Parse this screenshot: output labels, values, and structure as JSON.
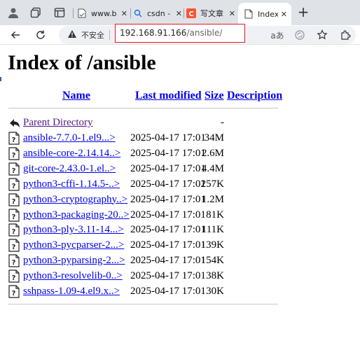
{
  "browser": {
    "tabs": [
      {
        "title": "www.b",
        "favicon": "page-icon"
      },
      {
        "title": "csdn -",
        "favicon": "search-icon"
      },
      {
        "title": "写文章",
        "favicon": "csdn-icon"
      },
      {
        "title": "Index",
        "favicon": "page-icon",
        "active": true
      }
    ],
    "close_glyph": "✕",
    "new_tab_glyph": "+",
    "security_label": "不安全",
    "url_host": "192.168.91.166",
    "url_path": "/ansible/",
    "read_aloud_glyph": "aあ",
    "colors": {
      "tabstrip": "#dfe3e8",
      "highlight_border": "#e2191c",
      "csdn_brand": "#fc5531"
    }
  },
  "page": {
    "heading": "Index of /ansible",
    "columns": {
      "name": "Name",
      "last_modified": "Last modified",
      "size": "Size",
      "description": "Description"
    },
    "parent": {
      "name": "Parent Directory",
      "size": "-"
    },
    "files": [
      {
        "name": "ansible-7.7.0-1.el9...>",
        "modified": "2025-04-17 17:01",
        "size": "34M"
      },
      {
        "name": "ansible-core-2.14.14..>",
        "modified": "2025-04-17 17:01",
        "size": "2.6M"
      },
      {
        "name": "git-core-2.43.0-1.el..>",
        "modified": "2025-04-17 17:01",
        "size": "4.4M"
      },
      {
        "name": "python3-cffi-1.14.5-..>",
        "modified": "2025-04-17 17:01",
        "size": "257K"
      },
      {
        "name": "python3-cryptography..>",
        "modified": "2025-04-17 17:01",
        "size": "1.2M"
      },
      {
        "name": "python3-packaging-20..>",
        "modified": "2025-04-17 17:01",
        "size": "81K"
      },
      {
        "name": "python3-ply-3.11-14...>",
        "modified": "2025-04-17 17:01",
        "size": "111K"
      },
      {
        "name": "python3-pycparser-2...>",
        "modified": "2025-04-17 17:01",
        "size": "139K"
      },
      {
        "name": "python3-pyparsing-2...>",
        "modified": "2025-04-17 17:01",
        "size": "154K"
      },
      {
        "name": "python3-resolvelib-0..>",
        "modified": "2025-04-17 17:01",
        "size": "38K"
      },
      {
        "name": "sshpass-1.09-4.el9.x..>",
        "modified": "2025-04-17 17:01",
        "size": "30K"
      }
    ],
    "colors": {
      "link": "#0000ee",
      "visited": "#551a8b"
    }
  }
}
